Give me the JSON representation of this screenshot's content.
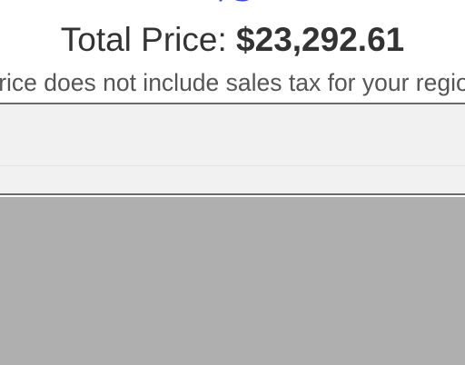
{
  "header": {
    "partial_heading": "VS"
  },
  "pricing": {
    "total_label": "Total Price:",
    "total_amount": "$23,292.61",
    "tax_note": "Price does not include sales tax for your region"
  }
}
